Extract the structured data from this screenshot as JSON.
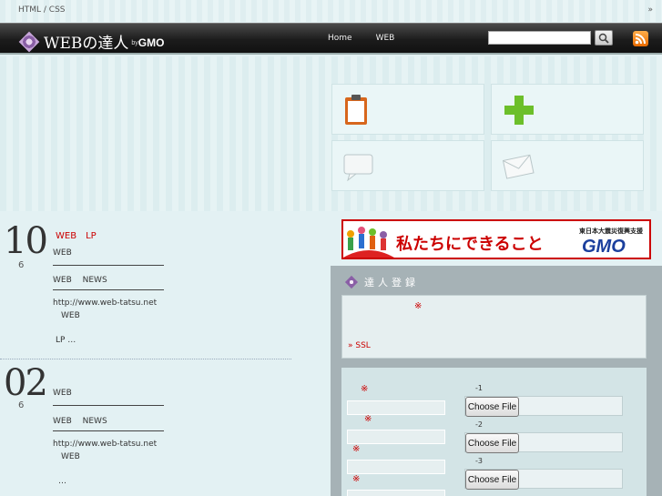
{
  "breadcrumb": {
    "text": "HTML / CSS",
    "more": "»"
  },
  "header": {
    "logo_text": "WEBの達人",
    "logo_by": "by",
    "logo_brand": "GMO",
    "nav": [
      "Home",
      "WEB"
    ],
    "search_placeholder": ""
  },
  "posts": [
    {
      "day": "10",
      "month": "6",
      "tags": "WEB　LP",
      "line1": "WEB",
      "line2": "WEB　 NEWS",
      "url": "http://www.web-tatsu.net",
      "url_sub": "WEB",
      "more": "LP …"
    },
    {
      "day": "02",
      "month": "6",
      "line1": "WEB",
      "line2": "WEB　 NEWS",
      "url": "http://www.web-tatsu.net",
      "url_sub": "WEB",
      "more": "…"
    }
  ],
  "banner": {
    "headline": "私たちにできること",
    "sub": "東日本大震災復興支援",
    "brand": "GMO"
  },
  "register": {
    "title": "達人登録",
    "required_mark": "※",
    "ssl_link": "» SSL",
    "file_labels": [
      "-1",
      "-2",
      "-3"
    ],
    "file_button": "Choose File"
  },
  "colors": {
    "accent_red": "#cc0000",
    "header_bg": "#1c1c1c",
    "panel_bg": "#a6b2b6"
  }
}
